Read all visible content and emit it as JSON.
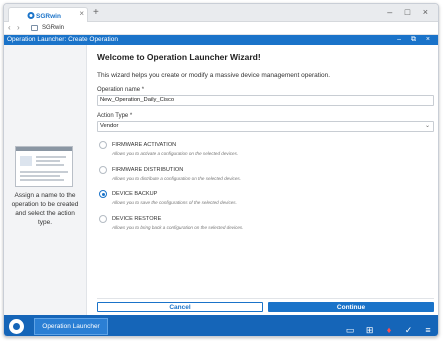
{
  "browser": {
    "tab_logo_text": "SGRwin",
    "tab_close": "×",
    "new_tab": "+",
    "window_controls": "– □ ×",
    "nav_back": "‹",
    "nav_forward": "›",
    "address": "SGRwin"
  },
  "app": {
    "title": "Operation Launcher: Create Operation",
    "title_controls": "– ⧉ ×"
  },
  "left_panel": {
    "description": "Assign a name to the operation to be created and select the action type."
  },
  "wizard": {
    "title": "Welcome to Operation Launcher Wizard!",
    "description": "This wizard helps you create or modify a massive device management operation.",
    "operation_name_label": "Operation name *",
    "operation_name_value": "New_Operation_Daily_Cisco",
    "action_type_label": "Action Type *",
    "action_type_value": "Vendor",
    "options": [
      {
        "title": "FIRMWARE ACTIVATION",
        "desc": "Allows you to activate a configuration on the selected devices.",
        "selected": false
      },
      {
        "title": "FIRMWARE DISTRIBUTION",
        "desc": "Allows you to distribute a configuration on the selected devices.",
        "selected": false
      },
      {
        "title": "DEVICE BACKUP",
        "desc": "Allows you to save the configurations of the selected devices.",
        "selected": true
      },
      {
        "title": "DEVICE RESTORE",
        "desc": "Allows you to bring back a configuration on the selected devices.",
        "selected": false
      }
    ],
    "cancel_label": "Cancel",
    "continue_label": "Continue"
  },
  "taskbar": {
    "app_label": "Operation Launcher",
    "icons": [
      "windows-icon",
      "grid-icon",
      "bell-icon",
      "check-icon",
      "list-icon"
    ]
  },
  "colors": {
    "accent": "#1a73c9",
    "taskbar": "#1565b8",
    "alert": "#ff4d4d"
  }
}
